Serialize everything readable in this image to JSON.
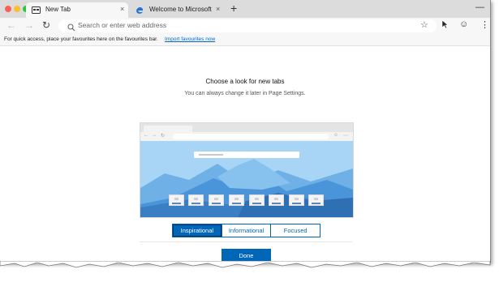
{
  "window": {
    "traffic_lights": {
      "close_color": "#fd5f57",
      "minimize_color": "#febc2e",
      "zoom_color": "#28c840"
    }
  },
  "tabs": [
    {
      "title": "New Tab",
      "active": true,
      "icon": "new-tab-icon"
    },
    {
      "title": "Welcome to Microsoft Edge De",
      "active": false,
      "icon": "edge-logo-icon"
    }
  ],
  "toolbar": {
    "address_placeholder": "Search or enter web address",
    "icons": [
      "back-arrow-icon",
      "forward-arrow-icon",
      "refresh-icon",
      "search-icon",
      "star-icon",
      "cursor-icon",
      "smiley-icon",
      "more-icon"
    ]
  },
  "favourites_bar": {
    "message": "For quick access, place your favourites here on the favourites bar.",
    "link": "Import favourites now"
  },
  "page": {
    "heading": "Choose a look for new tabs",
    "subheading": "You can always change it later in Page Settings.",
    "look_options": [
      "Inspirational",
      "Informational",
      "Focused"
    ],
    "selected_look": "Inspirational",
    "done_label": "Done",
    "accent_color": "#0067b8",
    "link_color": "#0066cc"
  }
}
